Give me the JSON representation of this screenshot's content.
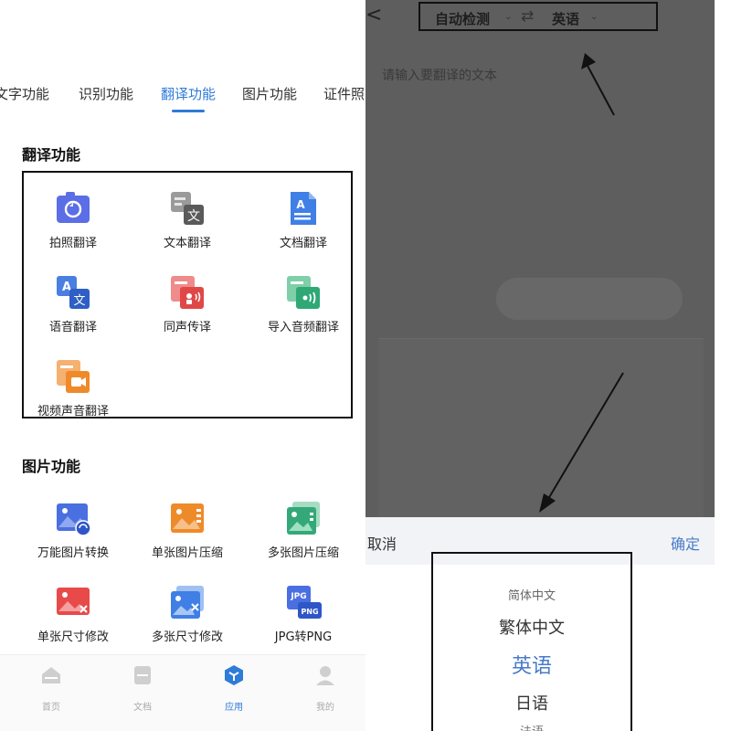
{
  "colors": {
    "accent": "#2f7bd8",
    "confirm": "#4a7bc8",
    "overlay": "#5e5e5e",
    "outline": "#111111"
  },
  "left": {
    "tabs": [
      {
        "label": "文字功能",
        "active": false
      },
      {
        "label": "识别功能",
        "active": false
      },
      {
        "label": "翻译功能",
        "active": true
      },
      {
        "label": "图片功能",
        "active": false
      },
      {
        "label": "证件照",
        "active": false
      }
    ],
    "translate_section": {
      "title": "翻译功能",
      "items": [
        {
          "label": "拍照翻译",
          "icon": "camera-translate-icon"
        },
        {
          "label": "文本翻译",
          "icon": "text-translate-icon"
        },
        {
          "label": "文档翻译",
          "icon": "document-translate-icon"
        },
        {
          "label": "语音翻译",
          "icon": "voice-translate-icon"
        },
        {
          "label": "同声传译",
          "icon": "simultaneous-interpret-icon"
        },
        {
          "label": "导入音频翻译",
          "icon": "import-audio-translate-icon"
        },
        {
          "label": "视频声音翻译",
          "icon": "video-audio-translate-icon"
        }
      ]
    },
    "image_section": {
      "title": "图片功能",
      "items": [
        {
          "label": "万能图片转换",
          "icon": "image-convert-icon"
        },
        {
          "label": "单张图片压缩",
          "icon": "single-image-compress-icon"
        },
        {
          "label": "多张图片压缩",
          "icon": "multi-image-compress-icon"
        },
        {
          "label": "单张尺寸修改",
          "icon": "single-resize-icon"
        },
        {
          "label": "多张尺寸修改",
          "icon": "multi-resize-icon"
        },
        {
          "label": "JPG转PNG",
          "icon": "jpg-to-png-icon"
        }
      ]
    },
    "bottom_nav": [
      {
        "label": "首页",
        "icon": "home-icon",
        "active": false
      },
      {
        "label": "文档",
        "icon": "document-icon",
        "active": false
      },
      {
        "label": "应用",
        "icon": "apps-cube-icon",
        "active": true
      },
      {
        "label": "我的",
        "icon": "profile-icon",
        "active": false
      }
    ]
  },
  "right": {
    "back_label": "<",
    "source_lang": "自动检测",
    "target_lang": "英语",
    "swap_symbol": "⇄",
    "input_placeholder": "请输入要翻译的文本",
    "sheet": {
      "cancel": "取消",
      "confirm": "确定"
    },
    "picker_options": [
      {
        "label": "简体中文",
        "state": "near"
      },
      {
        "label": "繁体中文",
        "state": "adjacent"
      },
      {
        "label": "英语",
        "state": "selected"
      },
      {
        "label": "日语",
        "state": "adjacent"
      },
      {
        "label": "法语",
        "state": "near"
      }
    ]
  }
}
